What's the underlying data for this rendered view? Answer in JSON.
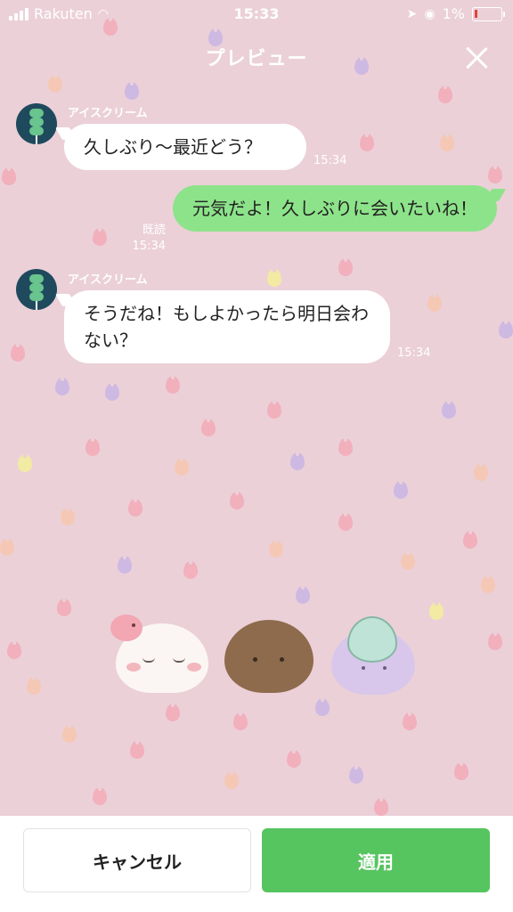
{
  "status_bar": {
    "carrier": "Rakuten",
    "time": "15:33",
    "battery_percent": "1%"
  },
  "header": {
    "title": "プレビュー"
  },
  "messages": [
    {
      "direction": "incoming",
      "sender": "アイスクリーム",
      "text": "久しぶり〜最近どう？",
      "time": "15:34"
    },
    {
      "direction": "outgoing",
      "read_label": "既読",
      "text": "元気だよ！久しぶりに会いたいね！",
      "time": "15:34"
    },
    {
      "direction": "incoming",
      "sender": "アイスクリーム",
      "text": "そうだね！もしよかったら明日会わない？",
      "time": "15:34"
    }
  ],
  "buttons": {
    "cancel_label": "キャンセル",
    "apply_label": "適用"
  },
  "colors": {
    "background": "#ebd0d8",
    "outgoing_bubble": "#8de38a",
    "apply_button": "#56c45f"
  }
}
